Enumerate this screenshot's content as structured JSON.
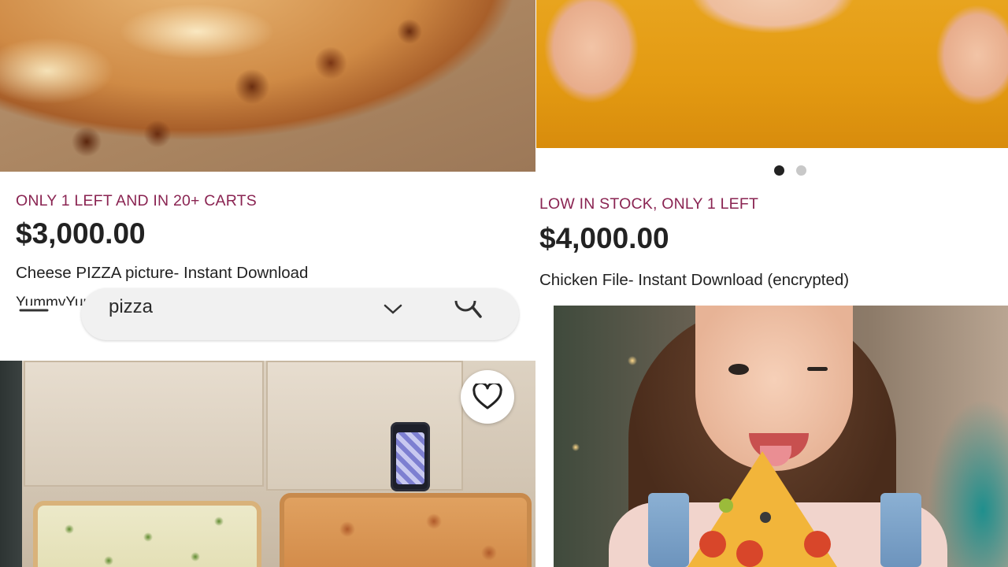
{
  "listings": [
    {
      "stock_note": "ONLY 1 LEFT AND IN 20+ CARTS",
      "price": "$3,000.00",
      "title": "Cheese PIZZA picture- Instant Download",
      "shop": "YummyYumPizza"
    },
    {
      "stock_note": "LOW IN STOCK, ONLY 1 LEFT",
      "price": "$4,000.00",
      "title": "Chicken File- Instant Download (encrypted)"
    }
  ],
  "carousel": {
    "total_dots": 2,
    "active_index": 0
  },
  "search": {
    "query": "pizza"
  },
  "icons": {
    "menu": "hamburger-menu-icon",
    "clear": "close-icon",
    "search": "search-icon",
    "favorite": "heart-outline-icon"
  },
  "colors": {
    "stock_note": "#8a2452",
    "price_text": "#222222",
    "dot_active": "#222222",
    "dot_inactive": "#c8c8c8",
    "search_pill": "#f1f1f1"
  }
}
